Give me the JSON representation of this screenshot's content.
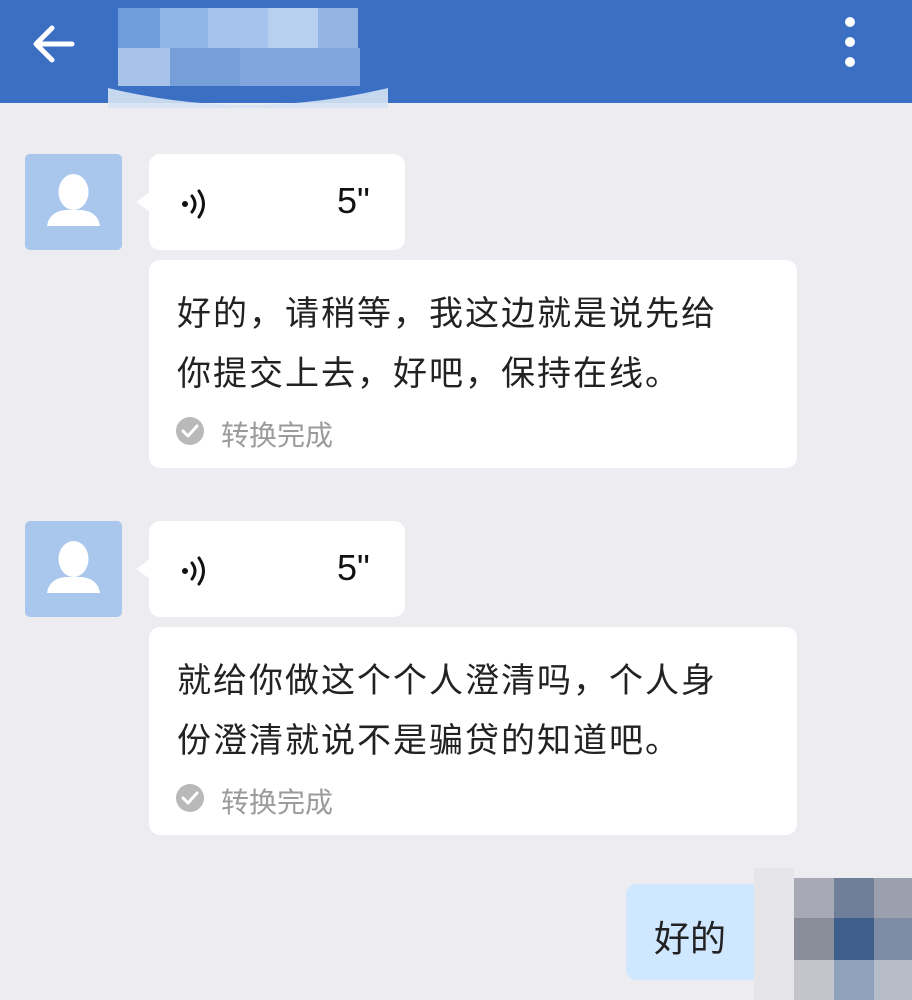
{
  "header": {
    "back_icon": "arrow-left-icon",
    "more_icon": "more-vertical-icon",
    "contact_name_obscured": true
  },
  "messages": [
    {
      "sender": "other",
      "voice": {
        "icon": "voice-wave-icon",
        "duration": "5\""
      },
      "transcript": {
        "lines": [
          "好的，请稍等，我这边就是说先给",
          "你提交上去，好吧，保持在线。"
        ],
        "status_icon": "check-circle-icon",
        "status": "转换完成"
      }
    },
    {
      "sender": "other",
      "voice": {
        "icon": "voice-wave-icon",
        "duration": "5\""
      },
      "transcript": {
        "lines": [
          "就给你做这个个人澄清吗，个人身",
          "份澄清就说不是骗贷的知道吧。"
        ],
        "status_icon": "check-circle-icon",
        "status": "转换完成"
      }
    },
    {
      "sender": "me",
      "text": "好的",
      "avatar_obscured": true
    }
  ],
  "colors": {
    "header": "#3b6fc4",
    "background": "#ececf1",
    "avatar": "#a9c7ec",
    "my_bubble": "#cfe8ff",
    "status_text": "#9b9b9b"
  }
}
